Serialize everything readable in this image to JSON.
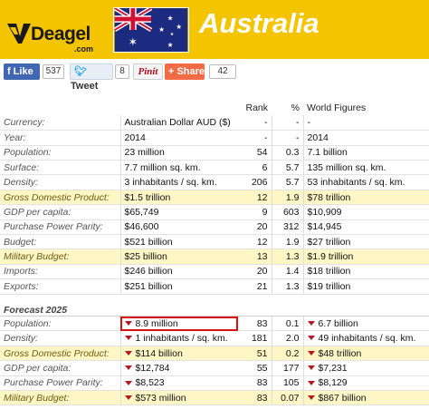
{
  "header": {
    "logo_text": "Deagel",
    "logo_domain": ".com",
    "title": "Australia",
    "flag_icon": "australia-flag-icon",
    "banner_color": "#f5c400"
  },
  "social": {
    "facebook_label": "Like",
    "facebook_count": "537",
    "twitter_label": "Tweet",
    "twitter_count": "8",
    "pinterest_label": "Pinit",
    "share_label": "Share",
    "share_count": "42"
  },
  "table": {
    "columns": [
      "",
      "",
      "Rank",
      "%",
      "World Figures"
    ],
    "rows": [
      {
        "label": "Currency:",
        "value": "Australian Dollar AUD ($)",
        "rank": "-",
        "pct": "-",
        "world": "-",
        "hl": false
      },
      {
        "label": "Year:",
        "value": "2014",
        "rank": "-",
        "pct": "-",
        "world": "2014",
        "hl": false
      },
      {
        "label": "Population:",
        "value": "23 million",
        "rank": "54",
        "pct": "0.3",
        "world": "7.1 billion",
        "hl": false
      },
      {
        "label": "Surface:",
        "value": "7.7 million sq. km.",
        "rank": "6",
        "pct": "5.7",
        "world": "135 million sq. km.",
        "hl": false
      },
      {
        "label": "Density:",
        "value": "3 inhabitants / sq. km.",
        "rank": "206",
        "pct": "5.7",
        "world": "53 inhabitants / sq. km.",
        "hl": false
      },
      {
        "label": "Gross Domestic Product:",
        "value": "$1.5 trillion",
        "rank": "12",
        "pct": "1.9",
        "world": "$78 trillion",
        "hl": true
      },
      {
        "label": "GDP per capita:",
        "value": "$65,749",
        "rank": "9",
        "pct": "603",
        "world": "$10,909",
        "hl": false
      },
      {
        "label": "Purchase Power Parity:",
        "value": "$46,600",
        "rank": "20",
        "pct": "312",
        "world": "$14,945",
        "hl": false
      },
      {
        "label": "Budget:",
        "value": "$521 billion",
        "rank": "12",
        "pct": "1.9",
        "world": "$27 trillion",
        "hl": false
      },
      {
        "label": "Military Budget:",
        "value": "$25 billion",
        "rank": "13",
        "pct": "1.3",
        "world": "$1.9 trillion",
        "hl": true
      },
      {
        "label": "Imports:",
        "value": "$246 billion",
        "rank": "20",
        "pct": "1.4",
        "world": "$18 trillion",
        "hl": false
      },
      {
        "label": "Exports:",
        "value": "$251 billion",
        "rank": "21",
        "pct": "1.3",
        "world": "$19 trillion",
        "hl": false
      }
    ],
    "forecast_title": "Forecast 2025",
    "forecast_rows": [
      {
        "label": "Population:",
        "value": "8.9 million",
        "rank": "83",
        "pct": "0.1",
        "world": "6.7 billion",
        "hl": false,
        "boxed": true
      },
      {
        "label": "Density:",
        "value": "1 inhabitants / sq. km.",
        "rank": "181",
        "pct": "2.0",
        "world": "49 inhabitants / sq. km.",
        "hl": false,
        "boxed": false
      },
      {
        "label": "Gross Domestic Product:",
        "value": "$114 billion",
        "rank": "51",
        "pct": "0.2",
        "world": "$48 trillion",
        "hl": true,
        "boxed": false
      },
      {
        "label": "GDP per capita:",
        "value": "$12,784",
        "rank": "55",
        "pct": "177",
        "world": "$7,231",
        "hl": false,
        "boxed": false
      },
      {
        "label": "Purchase Power Parity:",
        "value": "$8,523",
        "rank": "83",
        "pct": "105",
        "world": "$8,129",
        "hl": false,
        "boxed": false
      },
      {
        "label": "Military Budget:",
        "value": "$573 million",
        "rank": "83",
        "pct": "0.07",
        "world": "$867 billion",
        "hl": true,
        "boxed": false
      }
    ],
    "highlight_color": "#fff6c6",
    "decrease_icon": "down-triangle-icon",
    "decrease_color": "#b8191f"
  }
}
